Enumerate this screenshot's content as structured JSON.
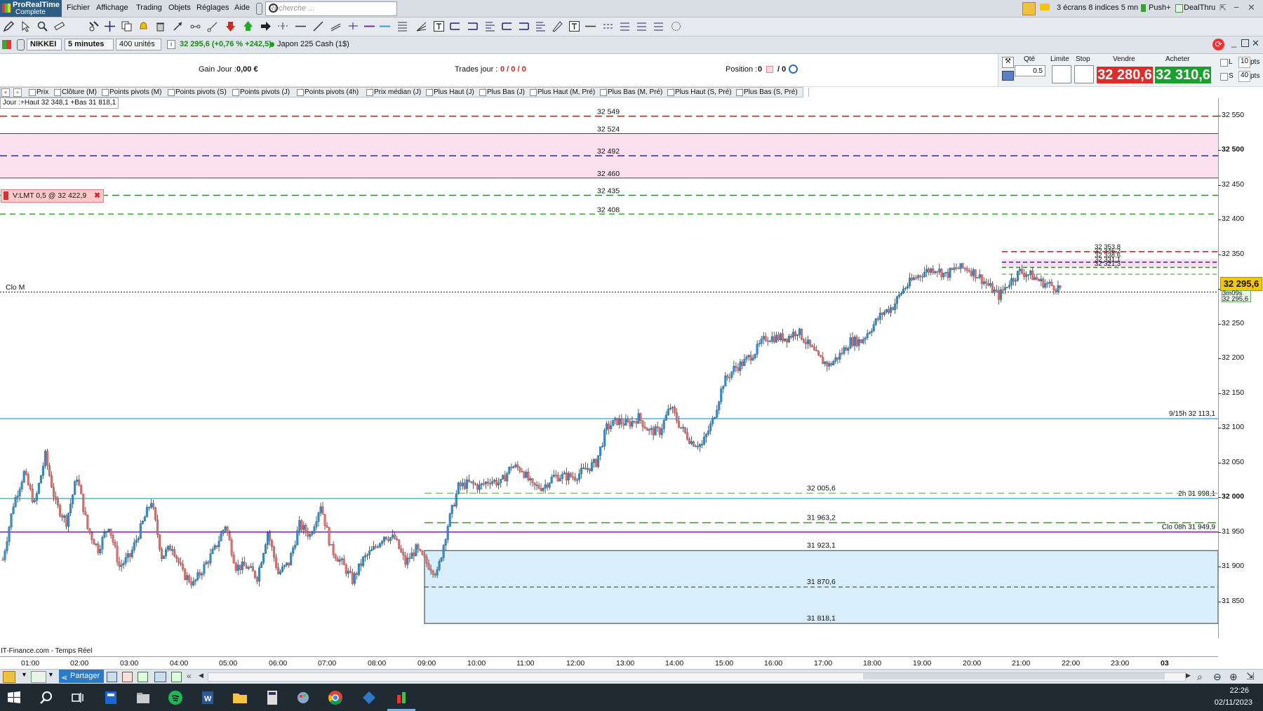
{
  "menubar": {
    "brand_line1": "ProRealTime",
    "brand_line2": "Complete",
    "items": [
      "Fichier",
      "Affichage",
      "Trading",
      "Objets",
      "Réglages",
      "Aide"
    ],
    "search_placeholder": "Recherche ...",
    "layout_label": "3 écrans 8 indices 5 mn",
    "push_label": "Push+",
    "dealthru_label": "DealThru"
  },
  "instrument": {
    "symbol": "NIKKEI",
    "interval": "5 minutes",
    "units": "400 unités",
    "quote": "32 295,6 (+0,76 % +242,5)",
    "name": "Japon 225 Cash (1$)"
  },
  "trading": {
    "gain_label": "Gain Jour :",
    "gain_value": "0,00 €",
    "trades_label": "Trades jour :",
    "trades_value": "0 / 0 / 0",
    "position_label": "Position :",
    "position_value": "0",
    "position_extra": "/ 0",
    "qty_label": "Qté",
    "qty_value": "0.5",
    "limit_label": "Limite",
    "stop_label": "Stop",
    "sell_label": "Vendre",
    "buy_label": "Acheter",
    "sell_price": "32 280,6",
    "buy_price": "32 310,6",
    "l_label": "L",
    "s_label": "S",
    "l_pts": "10",
    "s_pts": "40",
    "pts_label": "pts"
  },
  "indicators": [
    "Prix",
    "Clôture (M)",
    "Points pivots (M)",
    "Points pivots (S)",
    "Points pivots (J)",
    "Points pivots (4h)",
    "Prix médian (J)",
    "Plus Haut (J)",
    "Plus Bas (J)",
    "Plus Haut (M, Pré)",
    "Plus Bas (M, Pré)",
    "Plus Haut (S, Pré)",
    "Plus Bas (S, Pré)"
  ],
  "chart_data": {
    "type": "candlestick",
    "day_info": "Jour :+Haut 32 348,1 +Bas 31 818,1",
    "order_label": "V:LMT  0,5 @ 32 422,9",
    "clo_m_label": "Clo M",
    "source_label": "IT-Finance.com - Temps Réel",
    "ylim": [
      31797,
      32575
    ],
    "y_ticks": [
      "32 550",
      "32 500",
      "32 450",
      "32 400",
      "32 350",
      "32 300",
      "32 250",
      "32 200",
      "32 150",
      "32 100",
      "32 050",
      "32 000",
      "31 950",
      "31 900",
      "31 850"
    ],
    "x_ticks": [
      "01:00",
      "02:00",
      "03:00",
      "04:00",
      "05:00",
      "06:00",
      "07:00",
      "08:00",
      "09:00",
      "10:00",
      "11:00",
      "12:00",
      "13:00",
      "14:00",
      "15:00",
      "16:00",
      "17:00",
      "18:00",
      "19:00",
      "20:00",
      "21:00",
      "22:00",
      "23:00",
      "03"
    ],
    "levels": [
      {
        "label": "32 549",
        "value": 32549,
        "style": "dash",
        "color": "#d42020"
      },
      {
        "label": "32 524",
        "value": 32524,
        "style": "solid",
        "color": "#444444"
      },
      {
        "label": "32 492",
        "value": 32492,
        "style": "dash",
        "color": "#3838a8"
      },
      {
        "label": "32 460",
        "value": 32460,
        "style": "solid",
        "color": "#444444"
      },
      {
        "label": "32 435",
        "value": 32435,
        "style": "dash",
        "color": "#2a9a2a"
      },
      {
        "label": "32 408",
        "value": 32408,
        "style": "dash2",
        "color": "#3aaa3a"
      }
    ],
    "right_labels": [
      {
        "label": "9/15h 32 113,1",
        "value": 32113.1,
        "color": "#2aa0d8"
      },
      {
        "label": "2h 31 998,1",
        "value": 31998.1,
        "color": "#2aa0d8"
      },
      {
        "label": "Clo 08h 31 949,9",
        "value": 31949.9,
        "color": "#7a2a9a"
      }
    ],
    "session_levels": [
      {
        "label": "32 005,6",
        "value": 32005.6
      },
      {
        "label": "31 963,2",
        "value": 31963.2
      },
      {
        "label": "31 923,1",
        "value": 31923.1
      },
      {
        "label": "31 870,6",
        "value": 31870.6
      },
      {
        "label": "31 818,1",
        "value": 31818.1
      }
    ],
    "small_levels": [
      "32 353,8",
      "32 346,2",
      "32 338,6",
      "32 331,1",
      "32 321,3"
    ],
    "clo_m_value": 32295.6,
    "last_price": "32 295,6",
    "timer": "3m09s",
    "timer_price": "32 295,6",
    "close_path": [
      [
        0,
        31910
      ],
      [
        5,
        31990
      ],
      [
        10,
        32035
      ],
      [
        15,
        31990
      ],
      [
        20,
        32060
      ],
      [
        25,
        31990
      ],
      [
        30,
        31965
      ],
      [
        35,
        32030
      ],
      [
        40,
        31955
      ],
      [
        45,
        31925
      ],
      [
        50,
        31960
      ],
      [
        55,
        31900
      ],
      [
        60,
        31915
      ],
      [
        65,
        31955
      ],
      [
        70,
        31995
      ],
      [
        75,
        31915
      ],
      [
        80,
        31930
      ],
      [
        85,
        31890
      ],
      [
        90,
        31875
      ],
      [
        95,
        31900
      ],
      [
        100,
        31925
      ],
      [
        105,
        31960
      ],
      [
        110,
        31900
      ],
      [
        115,
        31900
      ],
      [
        120,
        31885
      ],
      [
        125,
        31950
      ],
      [
        130,
        31890
      ],
      [
        135,
        31905
      ],
      [
        140,
        31960
      ],
      [
        145,
        31945
      ],
      [
        150,
        31990
      ],
      [
        155,
        31925
      ],
      [
        160,
        31905
      ],
      [
        165,
        31880
      ],
      [
        170,
        31910
      ],
      [
        175,
        31925
      ],
      [
        180,
        31945
      ],
      [
        185,
        31940
      ],
      [
        190,
        31905
      ],
      [
        195,
        31925
      ],
      [
        200,
        31905
      ],
      [
        205,
        31890
      ],
      [
        210,
        31960
      ],
      [
        215,
        32015
      ],
      [
        220,
        32020
      ],
      [
        225,
        32015
      ],
      [
        230,
        32025
      ],
      [
        235,
        32020
      ],
      [
        240,
        32045
      ],
      [
        245,
        32040
      ],
      [
        250,
        32015
      ],
      [
        255,
        32015
      ],
      [
        260,
        32030
      ],
      [
        265,
        32030
      ],
      [
        270,
        32030
      ],
      [
        275,
        32040
      ],
      [
        280,
        32050
      ],
      [
        285,
        32100
      ],
      [
        290,
        32110
      ],
      [
        295,
        32105
      ],
      [
        300,
        32115
      ],
      [
        305,
        32095
      ],
      [
        310,
        32095
      ],
      [
        315,
        32130
      ],
      [
        320,
        32100
      ],
      [
        325,
        32080
      ],
      [
        330,
        32075
      ],
      [
        335,
        32110
      ],
      [
        340,
        32165
      ],
      [
        345,
        32185
      ],
      [
        350,
        32195
      ],
      [
        355,
        32210
      ],
      [
        360,
        32230
      ],
      [
        365,
        32230
      ],
      [
        370,
        32230
      ],
      [
        375,
        32240
      ],
      [
        380,
        32220
      ],
      [
        385,
        32200
      ],
      [
        390,
        32190
      ],
      [
        395,
        32205
      ],
      [
        400,
        32225
      ],
      [
        405,
        32225
      ],
      [
        410,
        32245
      ],
      [
        415,
        32265
      ],
      [
        420,
        32275
      ],
      [
        425,
        32300
      ],
      [
        430,
        32315
      ],
      [
        435,
        32325
      ],
      [
        440,
        32330
      ],
      [
        445,
        32320
      ],
      [
        450,
        32330
      ],
      [
        455,
        32330
      ],
      [
        460,
        32320
      ],
      [
        465,
        32305
      ],
      [
        470,
        32290
      ],
      [
        475,
        32310
      ],
      [
        480,
        32325
      ],
      [
        485,
        32320
      ],
      [
        490,
        32310
      ],
      [
        495,
        32305
      ],
      [
        500,
        32300
      ]
    ]
  },
  "bottombar": {
    "share_label": "Partager"
  },
  "taskbar": {
    "time": "22:26",
    "date": "02/11/2023"
  }
}
